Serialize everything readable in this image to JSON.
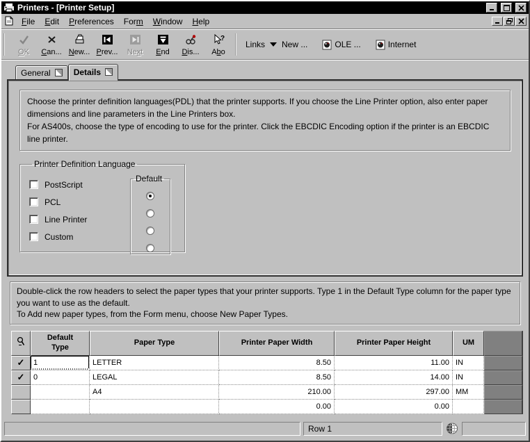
{
  "window": {
    "title": "Printers - [Printer Setup]"
  },
  "menu": {
    "items": [
      {
        "pre": "",
        "key": "F",
        "post": "ile"
      },
      {
        "pre": "",
        "key": "E",
        "post": "dit"
      },
      {
        "pre": "",
        "key": "P",
        "post": "references"
      },
      {
        "pre": "For",
        "key": "m",
        "post": ""
      },
      {
        "pre": "",
        "key": "W",
        "post": "indow"
      },
      {
        "pre": "",
        "key": "H",
        "post": "elp"
      }
    ]
  },
  "toolbar": {
    "buttons": [
      {
        "pre": "",
        "key": "O",
        "post": "K",
        "disabled": true,
        "icon": "ok-check-icon"
      },
      {
        "pre": "",
        "key": "C",
        "post": "an...",
        "disabled": false,
        "icon": "cancel-x-icon"
      },
      {
        "pre": "",
        "key": "N",
        "post": "ew...",
        "disabled": false,
        "icon": "new-icon"
      },
      {
        "pre": "",
        "key": "P",
        "post": "rev...",
        "disabled": false,
        "icon": "previous-icon"
      },
      {
        "pre": "Ne",
        "key": "x",
        "post": "t",
        "disabled": true,
        "icon": "next-icon"
      },
      {
        "pre": "",
        "key": "E",
        "post": "nd",
        "disabled": false,
        "icon": "end-icon"
      },
      {
        "pre": "",
        "key": "D",
        "post": "is...",
        "disabled": false,
        "icon": "display-icon"
      },
      {
        "pre": "A",
        "key": "b",
        "post": "o",
        "disabled": false,
        "icon": "about-icon"
      }
    ],
    "links_label": "Links",
    "links_new_label": "New ...",
    "ole_label": "OLE ...",
    "internet_label": "Internet"
  },
  "tabs": [
    {
      "label": "General",
      "active": false
    },
    {
      "label": "Details",
      "active": true
    }
  ],
  "details_tab": {
    "instructions_top_1": "Choose the printer definition languages(PDL) that the printer supports. If you choose the Line Printer option, also enter paper dimensions and line parameters in the Line Printers box.",
    "instructions_top_2": "For AS400s, choose the type of encoding to use for the printer. Click the EBCDIC Encoding option if the printer is an EBCDIC line printer.",
    "pdl_group": {
      "title": "Printer Definition Language",
      "checkboxes": [
        {
          "label": "PostScript",
          "checked": false
        },
        {
          "label": "PCL",
          "checked": false
        },
        {
          "label": "Line Printer",
          "checked": false
        },
        {
          "label": "Custom",
          "checked": false
        }
      ],
      "default_group_title": "Default",
      "default_options": 4,
      "selected_default_index": 0
    }
  },
  "paper_section": {
    "instructions_1": "Double-click the row headers to select the paper types that your printer supports.  Type 1 in the Default Type column for the paper type you want to use as the default.",
    "instructions_2": "To Add new paper types, from the Form menu, choose New Paper Types.",
    "grid": {
      "headers": [
        "Default Type",
        "Paper Type",
        "Printer Paper Width",
        "Printer Paper Height",
        "UM"
      ],
      "rows": [
        {
          "check": "✓",
          "default_type": "1",
          "paper_type": "LETTER",
          "width": "8.50",
          "height": "11.00",
          "um": "IN"
        },
        {
          "check": "✓",
          "default_type": "0",
          "paper_type": "LEGAL",
          "width": "8.50",
          "height": "14.00",
          "um": "IN"
        },
        {
          "check": "",
          "default_type": "",
          "paper_type": "A4",
          "width": "210.00",
          "height": "297.00",
          "um": "MM"
        },
        {
          "check": "",
          "default_type": "",
          "paper_type": "",
          "width": "0.00",
          "height": "0.00",
          "um": ""
        }
      ]
    }
  },
  "statusbar": {
    "row_label": "Row 1"
  },
  "colors": {
    "window_bg": "#c0c0c0",
    "title_bar": "#000000",
    "grid_filler": "#808080",
    "disabled_text": "#828282",
    "accent_red": "#c00000"
  }
}
